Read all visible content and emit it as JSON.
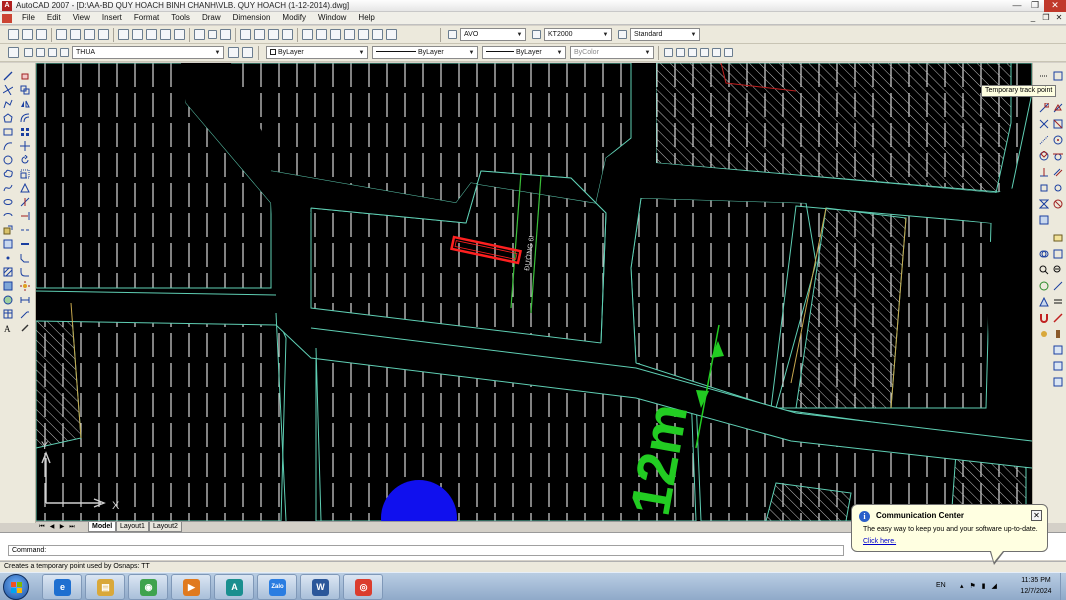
{
  "window": {
    "title": "AutoCAD 2007 - [D:\\AA-BD QUY HOACH BINH CHANH\\VLB. QUY HOACH (1-12-2014).dwg]",
    "min_label": "—",
    "max_label": "❐",
    "close_label": "✕"
  },
  "menu": {
    "items": [
      "File",
      "Edit",
      "View",
      "Insert",
      "Format",
      "Tools",
      "Draw",
      "Dimension",
      "Modify",
      "Window",
      "Help"
    ],
    "doc_min": "_",
    "doc_max": "❐",
    "doc_close": "✕"
  },
  "toolbar1": {
    "text_style": "AVO",
    "dim_style": "KT2000",
    "table_style": "Standard"
  },
  "toolbar2": {
    "layer": "THUA",
    "color": "ByLayer",
    "linetype": "ByLayer",
    "lineweight": "ByLayer",
    "plotstyle": "ByColor"
  },
  "drawing": {
    "road_label": "ĐƯỜNG 6I",
    "dimension_label": "12m",
    "ucs_x": "X",
    "ucs_y": "Y",
    "colors": {
      "background": "#000000",
      "parcel_outline": "#5fcfb4",
      "fence_lines": "#d8d8d8",
      "hatch": "#cfcfcf",
      "highlight_box": "#ff2020",
      "dimension": "#22cc22",
      "point_marker": "#1010ee",
      "tan_line": "#c8a84e"
    }
  },
  "tooltip": {
    "text": "Temporary track point"
  },
  "layout_tabs": {
    "nav": [
      "⏮",
      "◀",
      "▶",
      "⏭"
    ],
    "tabs": [
      {
        "label": "Model",
        "active": true
      },
      {
        "label": "Layout1",
        "active": false
      },
      {
        "label": "Layout2",
        "active": false
      }
    ]
  },
  "command": {
    "prompt": "Command:"
  },
  "status": {
    "text": "Creates a temporary point used by Osnaps:  TT"
  },
  "comm_center": {
    "title": "Communication Center",
    "body": "The easy way to keep you and your software up-to-date.",
    "link": "Click here.",
    "close": "✕",
    "info": "i"
  },
  "taskbar": {
    "apps": [
      {
        "name": "internet-explorer",
        "glyph": "e",
        "color": "#1e6fd0"
      },
      {
        "name": "file-explorer",
        "glyph": "▤",
        "color": "#d9a83a"
      },
      {
        "name": "coccoc-browser",
        "glyph": "◉",
        "color": "#3fa34d"
      },
      {
        "name": "media-player",
        "glyph": "▶",
        "color": "#e07a1f"
      },
      {
        "name": "autocad",
        "glyph": "A",
        "color": "#1a8f8f"
      },
      {
        "name": "zalo",
        "glyph": "Zalo",
        "color": "#2a7de1"
      },
      {
        "name": "word",
        "glyph": "W",
        "color": "#2b579a"
      },
      {
        "name": "chrome",
        "glyph": "◎",
        "color": "#db3d2e"
      }
    ],
    "language": "EN",
    "tray_glyphs": "▴ ⚑ ▮ ◢",
    "time": "11:35 PM",
    "date": "12/7/2024"
  }
}
